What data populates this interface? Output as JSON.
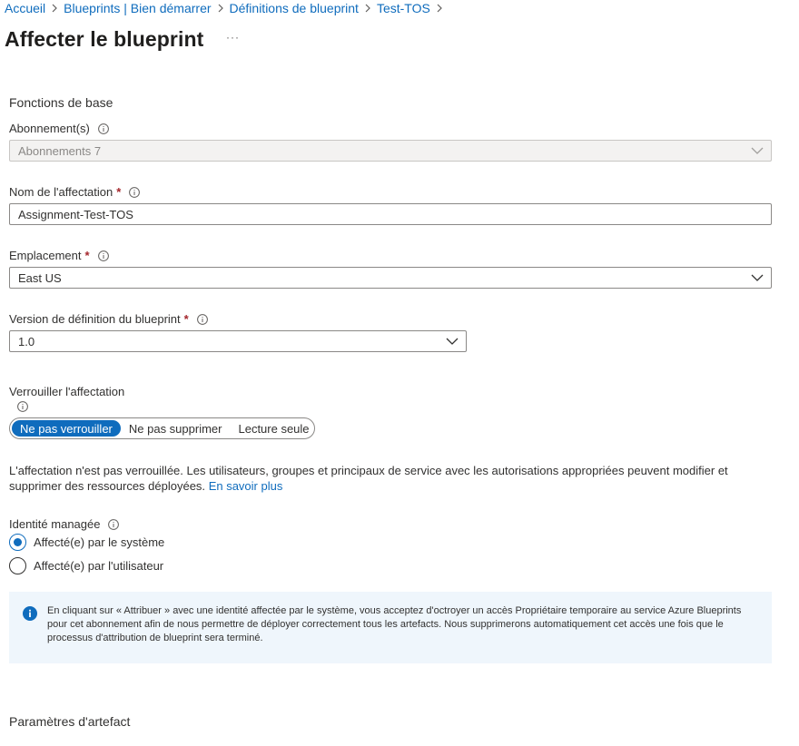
{
  "breadcrumb": [
    "Accueil",
    "Blueprints | Bien démarrer",
    "Définitions de blueprint",
    "Test-TOS"
  ],
  "page_title": "Affecter le blueprint",
  "more_label": "···",
  "basics": {
    "section_title": "Fonctions de base",
    "subscriptions_label": "Abonnement(s)",
    "subscriptions_value": "Abonnements 7",
    "assignment_name_label": "Nom de l'affectation",
    "assignment_name_value": "Assignment-Test-TOS",
    "location_label": "Emplacement",
    "location_value": "East US",
    "version_label": "Version de définition du blueprint",
    "version_value": "1.0",
    "required_mark": "*"
  },
  "lock": {
    "label": "Verrouiller l'affectation",
    "options": [
      "Ne pas verrouiller",
      "Ne pas supprimer",
      "Lecture seule"
    ],
    "selected": "Ne pas verrouiller",
    "description": "L'affectation n'est pas verrouillée. Les utilisateurs, groupes et principaux de service avec les autorisations appropriées peuvent modifier et supprimer des ressources déployées.",
    "learn_more": "En savoir plus"
  },
  "identity": {
    "label": "Identité managée",
    "options": [
      "Affecté(e) par le système",
      "Affecté(e) par l'utilisateur"
    ],
    "selected": "Affecté(e) par le système",
    "info_text": "En cliquant sur « Attribuer » avec une identité affectée par le système, vous acceptez d'octroyer un accès Propriétaire temporaire au service Azure Blueprints pour cet abonnement afin de nous permettre de déployer correctement tous les artefacts. Nous supprimerons automatiquement cet accès une fois que le processus d'attribution de blueprint sera terminé."
  },
  "artifacts": {
    "section_title": "Paramètres d'artefact"
  },
  "colors": {
    "accent": "#0f6cbd",
    "required": "#a4262c",
    "info_bg": "#eff6fc"
  }
}
